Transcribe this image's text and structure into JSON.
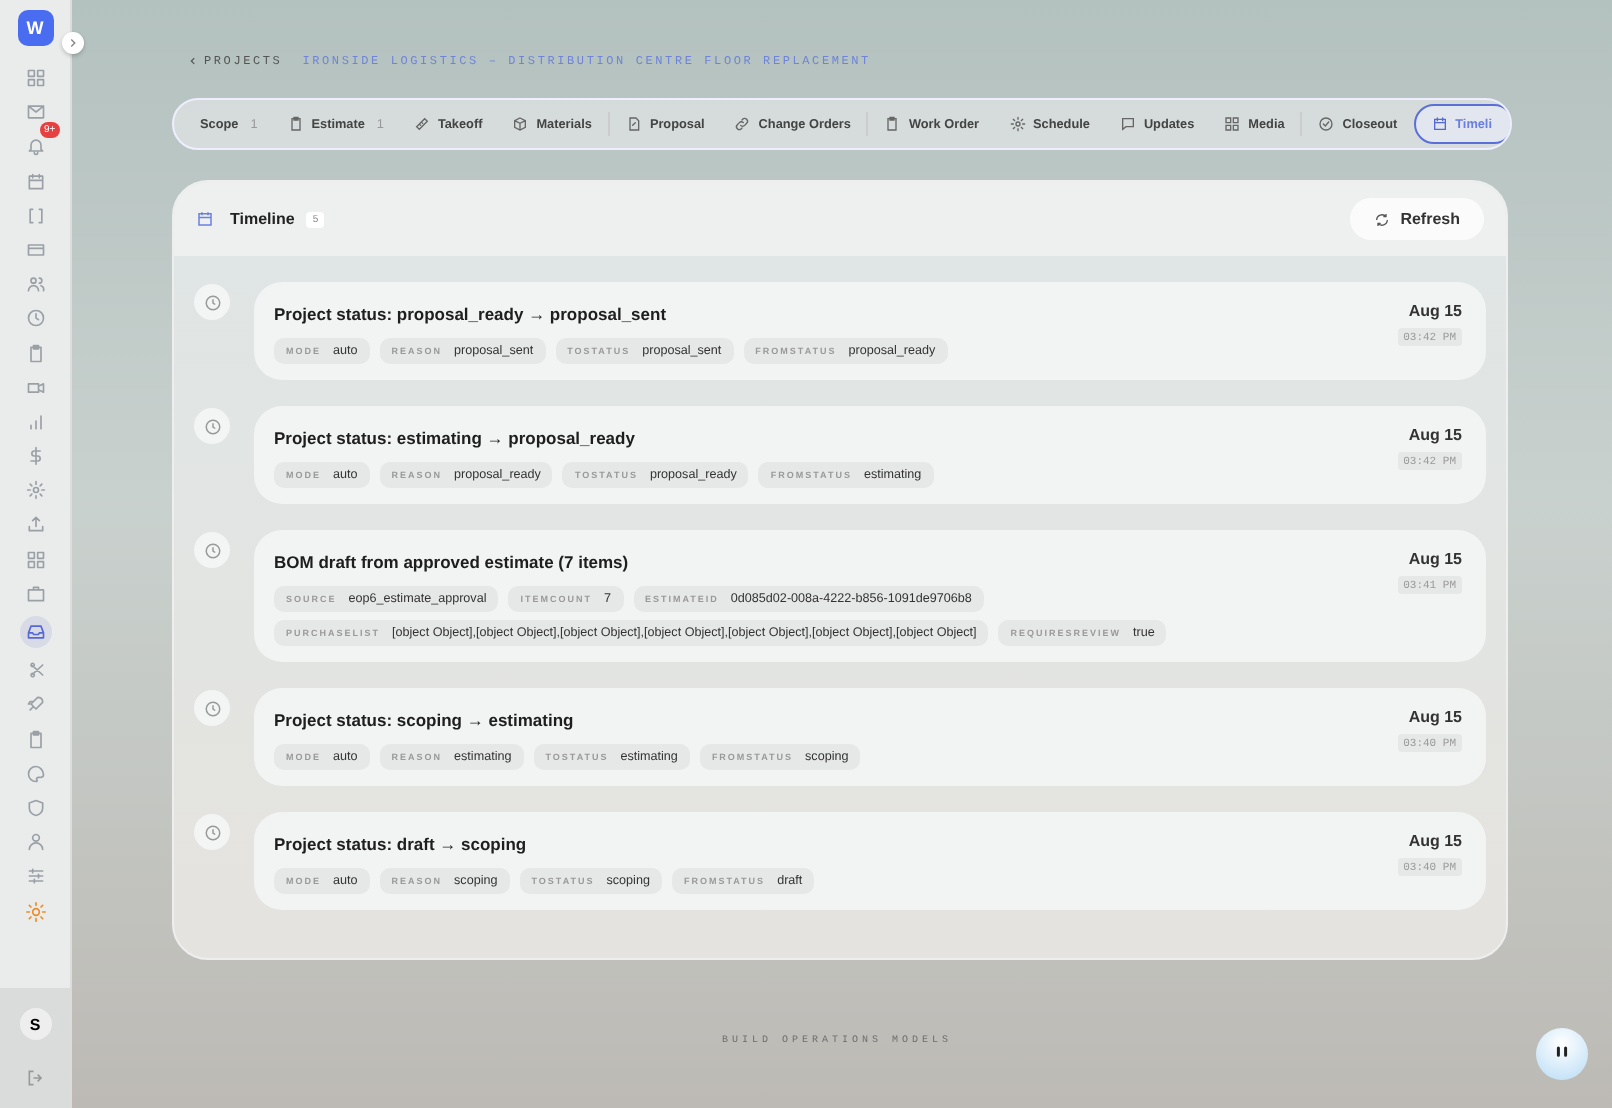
{
  "sidebar": {
    "logo": "W",
    "items": [
      {
        "kind": "grid",
        "selected": false
      },
      {
        "kind": "mail",
        "selected": false
      },
      {
        "kind": "bell",
        "selected": false,
        "badge": "9+"
      },
      {
        "kind": "calendar",
        "selected": false
      },
      {
        "kind": "brackets",
        "selected": false
      },
      {
        "kind": "card",
        "selected": false
      },
      {
        "kind": "users",
        "selected": false
      },
      {
        "kind": "clock",
        "selected": false
      },
      {
        "kind": "clipboard",
        "selected": false
      },
      {
        "kind": "video",
        "selected": false
      },
      {
        "kind": "bars",
        "selected": false
      },
      {
        "kind": "dollar",
        "selected": false
      },
      {
        "kind": "gear",
        "selected": false
      },
      {
        "kind": "upload",
        "selected": false
      },
      {
        "kind": "grid",
        "selected": false
      },
      {
        "kind": "briefcase",
        "selected": false
      },
      {
        "kind": "inbox",
        "selected": true
      },
      {
        "kind": "scissors",
        "selected": false
      },
      {
        "kind": "rocket",
        "selected": false
      },
      {
        "kind": "clipboard",
        "selected": false
      },
      {
        "kind": "palette",
        "selected": false
      },
      {
        "kind": "shield",
        "selected": false
      },
      {
        "kind": "person",
        "selected": false
      },
      {
        "kind": "sliders",
        "selected": false
      },
      {
        "kind": "sun",
        "selected": false
      }
    ],
    "avatar": "S"
  },
  "breadcrumb": {
    "back": "PROJECTS",
    "current": "IRONSIDE LOGISTICS – DISTRIBUTION CENTRE FLOOR REPLACEMENT"
  },
  "tabs": [
    {
      "label": "Scope",
      "kind": "plain",
      "count": "1",
      "selected": false
    },
    {
      "label": "Estimate",
      "kind": "clipboard",
      "count": "1",
      "selected": false
    },
    {
      "label": "Takeoff",
      "kind": "ruler",
      "selected": false
    },
    {
      "label": "Materials",
      "kind": "box",
      "selected": false,
      "divider": true
    },
    {
      "label": "Proposal",
      "kind": "doc",
      "selected": false
    },
    {
      "label": "Change Orders",
      "kind": "link",
      "selected": false,
      "divider": true
    },
    {
      "label": "Work Order",
      "kind": "clipboard",
      "selected": false
    },
    {
      "label": "Schedule",
      "kind": "gear",
      "selected": false
    },
    {
      "label": "Updates",
      "kind": "chat",
      "selected": false
    },
    {
      "label": "Media",
      "kind": "grid",
      "selected": false,
      "divider": true
    },
    {
      "label": "Closeout",
      "kind": "check",
      "selected": false
    },
    {
      "label": "Timeli",
      "kind": "calendar",
      "selected": true
    }
  ],
  "panel": {
    "title": "Timeline",
    "count": "5",
    "refresh": "Refresh"
  },
  "events": [
    {
      "title": "Project status: proposal_ready → proposal_sent",
      "date": "Aug 15",
      "time": "03:42 PM",
      "tags": [
        [
          {
            "key": "MODE",
            "value": "auto"
          },
          {
            "key": "REASON",
            "value": "proposal_sent"
          },
          {
            "key": "TOSTATUS",
            "value": "proposal_sent"
          },
          {
            "key": "FROMSTATUS",
            "value": "proposal_ready"
          }
        ]
      ]
    },
    {
      "title": "Project status: estimating → proposal_ready",
      "date": "Aug 15",
      "time": "03:42 PM",
      "tags": [
        [
          {
            "key": "MODE",
            "value": "auto"
          },
          {
            "key": "REASON",
            "value": "proposal_ready"
          },
          {
            "key": "TOSTATUS",
            "value": "proposal_ready"
          },
          {
            "key": "FROMSTATUS",
            "value": "estimating"
          }
        ]
      ]
    },
    {
      "title": "BOM draft from approved estimate (7 items)",
      "date": "Aug 15",
      "time": "03:41 PM",
      "tags": [
        [
          {
            "key": "SOURCE",
            "value": "eop6_estimate_approval"
          },
          {
            "key": "ITEMCOUNT",
            "value": "7"
          },
          {
            "key": "ESTIMATEID",
            "value": "0d085d02-008a-4222-b856-1091de9706b8"
          }
        ],
        [
          {
            "key": "PURCHASELIST",
            "value": "[object Object],[object Object],[object Object],[object Object],[object Object],[object Object],[object Object]"
          },
          {
            "key": "REQUIRESREVIEW",
            "value": "true"
          }
        ]
      ]
    },
    {
      "title": "Project status: scoping → estimating",
      "date": "Aug 15",
      "time": "03:40 PM",
      "tags": [
        [
          {
            "key": "MODE",
            "value": "auto"
          },
          {
            "key": "REASON",
            "value": "estimating"
          },
          {
            "key": "TOSTATUS",
            "value": "estimating"
          },
          {
            "key": "FROMSTATUS",
            "value": "scoping"
          }
        ]
      ]
    },
    {
      "title": "Project status: draft → scoping",
      "date": "Aug 15",
      "time": "03:40 PM",
      "tags": [
        [
          {
            "key": "MODE",
            "value": "auto"
          },
          {
            "key": "REASON",
            "value": "scoping"
          },
          {
            "key": "TOSTATUS",
            "value": "scoping"
          },
          {
            "key": "FROMSTATUS",
            "value": "draft"
          }
        ]
      ]
    }
  ],
  "footer": "BUILD OPERATIONS MODELS"
}
